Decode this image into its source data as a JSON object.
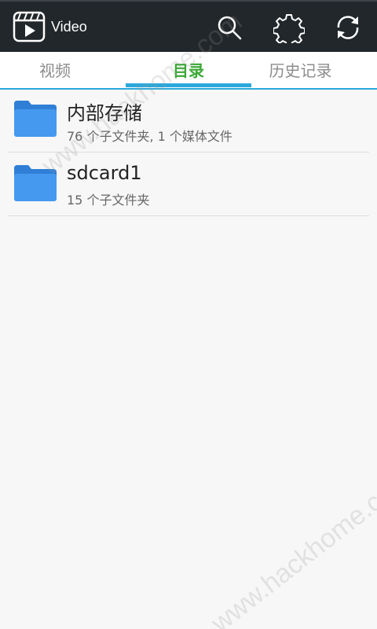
{
  "header": {
    "app_title": "Video",
    "logo_icon": "video-clapper-icon",
    "actions": [
      {
        "name": "search",
        "icon": "search-icon"
      },
      {
        "name": "settings",
        "icon": "gear-icon"
      },
      {
        "name": "refresh",
        "icon": "refresh-icon"
      }
    ]
  },
  "tabs": [
    {
      "label": "视频",
      "active": false
    },
    {
      "label": "目录",
      "active": true
    },
    {
      "label": "历史记录",
      "active": false
    }
  ],
  "folders": [
    {
      "name": "内部存储",
      "details": "76 个子文件夹, 1 个媒体文件",
      "icon": "folder-icon"
    },
    {
      "name": "sdcard1",
      "details": "15 个子文件夹",
      "icon": "folder-icon"
    }
  ],
  "watermark": "www.hackhome.com",
  "colors": {
    "topbar": "#22272b",
    "accent_blue": "#2aa8db",
    "active_tab": "#3aa935",
    "folder_blue": "#3b8fe6"
  }
}
